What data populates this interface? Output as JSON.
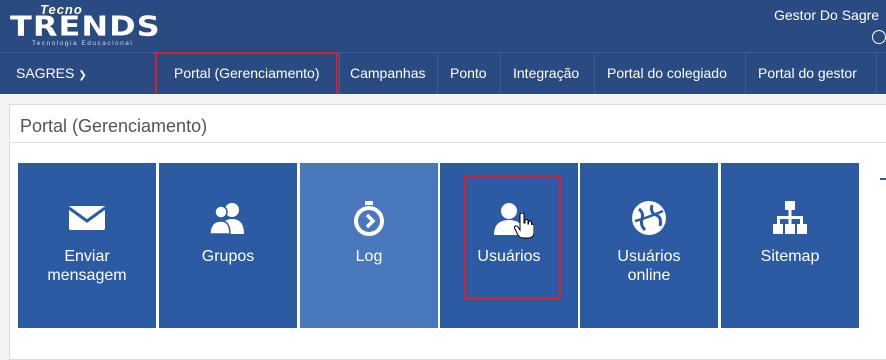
{
  "header": {
    "logo_prefix": "Tecno",
    "logo_main": "TRENDS",
    "logo_tagline": "Tecnologia Educacional",
    "user_name": "Gestor Do Sagre"
  },
  "nav": {
    "brand": "SAGRES",
    "items": [
      {
        "label": "Portal (Gerenciamento)",
        "active": true
      },
      {
        "label": "Campanhas"
      },
      {
        "label": "Ponto"
      },
      {
        "label": "Integração"
      },
      {
        "label": "Portal do colegiado"
      },
      {
        "label": "Portal do gestor"
      }
    ]
  },
  "page": {
    "title": "Portal (Gerenciamento)"
  },
  "tiles": [
    {
      "label_line1": "Enviar",
      "label_line2": "mensagem",
      "icon": "envelope-icon"
    },
    {
      "label_line1": "Grupos",
      "icon": "users-group-icon"
    },
    {
      "label_line1": "Log",
      "icon": "stopwatch-icon"
    },
    {
      "label_line1": "Usuários",
      "icon": "user-icon"
    },
    {
      "label_line1": "Usuários",
      "label_line2": "online",
      "icon": "globe-icon"
    },
    {
      "label_line1": "Sitemap",
      "icon": "sitemap-icon"
    }
  ],
  "colors": {
    "header_bg": "#2a4a82",
    "tile_bg": "#2c5ba3",
    "tile_hover_bg": "#4a78bd",
    "highlight": "#d8202a"
  }
}
